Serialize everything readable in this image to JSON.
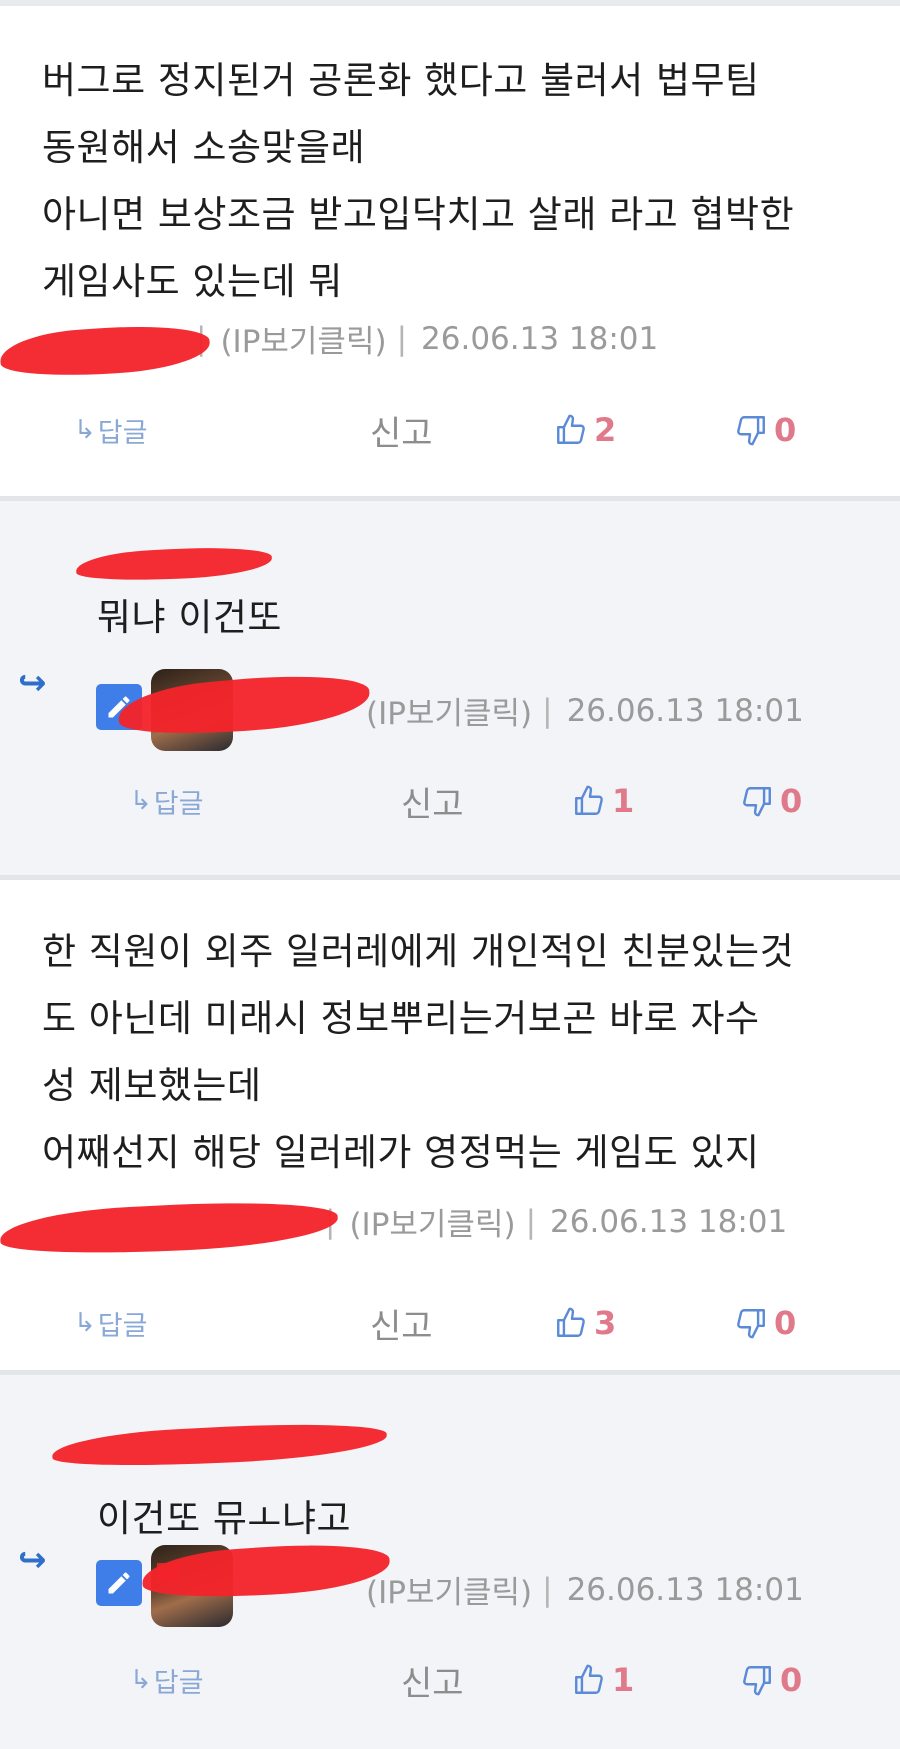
{
  "colors": {
    "reply_bg": "#f3f4f7",
    "accent_blue": "#3f7ee8",
    "vote_count": "#e07a8a",
    "redaction": "#f2242b"
  },
  "comments": [
    {
      "type": "comment",
      "text": "버그로 정지된거 공론화 했다고 불러서 법무팀\n동원해서 소송맞을래\n아니면 보상조금 받고입닥치고 살래 라고 협박한\n게임사도 있는데 뭐",
      "ip_label": "(IP보기클릭)",
      "separator": "|",
      "timestamp": "26.06.13 18:01",
      "reply_label": "답글",
      "report_label": "신고",
      "likes": "2",
      "dislikes": "0"
    },
    {
      "type": "reply",
      "text": "뭐냐 이건또",
      "ip_label": "(IP보기클릭)",
      "separator": "|",
      "timestamp": "26.06.13 18:01",
      "reply_label": "답글",
      "report_label": "신고",
      "likes": "1",
      "dislikes": "0"
    },
    {
      "type": "comment",
      "text": "한 직원이 외주 일러레에게 개인적인 친분있는것\n도 아닌데  미래시 정보뿌리는거보곤   바로 자수\n성 제보했는데\n어째선지 해당 일러레가 영정먹는 게임도 있지",
      "ip_label": "(IP보기클릭)",
      "separator": "|",
      "timestamp": "26.06.13 18:01",
      "reply_label": "답글",
      "report_label": "신고",
      "likes": "3",
      "dislikes": "0"
    },
    {
      "type": "reply",
      "text": "이건또 뮤ㅗ냐고",
      "ip_label": "(IP보기클릭)",
      "separator": "|",
      "timestamp": "26.06.13 18:01",
      "reply_label": "답글",
      "report_label": "신고",
      "likes": "1",
      "dislikes": "0"
    }
  ],
  "icons": {
    "reply_arrow": "reply-arrow-icon",
    "like": "thumbs-up-icon",
    "dislike": "thumbs-down-icon",
    "edit": "pencil-icon"
  }
}
